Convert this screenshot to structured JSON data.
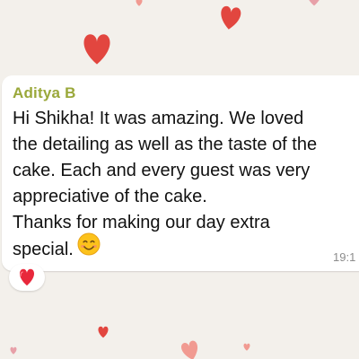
{
  "chat": {
    "wallpaper_icon": "heart-icon",
    "accent_colors": {
      "heart_red": "#e2463f",
      "heart_pink": "#f19a91",
      "sender_name": "#9aa83a"
    }
  },
  "message": {
    "sender": "Aditya B",
    "lines": [
      "Hi Shikha! It was amazing. We loved",
      "the detailing as well as the taste of the",
      "cake. Each and every guest was very",
      "appreciative of the cake.",
      "Thanks for making our day extra",
      "special."
    ],
    "emoji": "smiling-face-icon",
    "timestamp": "19:1",
    "reaction": "red-heart-icon"
  }
}
